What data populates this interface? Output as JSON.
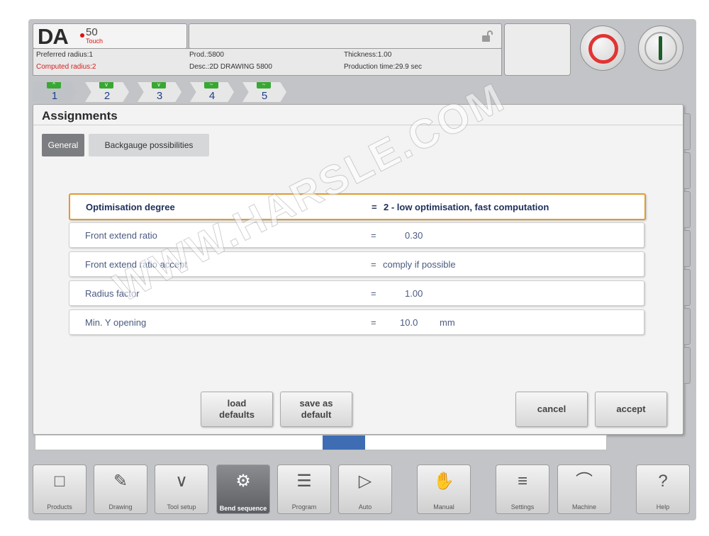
{
  "header": {
    "logo_brand": "DA",
    "logo_model": "50",
    "logo_sub": "Touch",
    "preferred_radius": "Preferred radius:1",
    "computed_radius": "Computed radius:2",
    "prod": "Prod.:5800",
    "desc": "Desc.:2D DRAWING 5800",
    "thickness": "Thickness:1.00",
    "production_time": "Production time:29.9 sec",
    "stop_color": "#e23434",
    "start_color": "#1c5d2a"
  },
  "bend_tabs": [
    {
      "num": "1",
      "badge": "^"
    },
    {
      "num": "2",
      "badge": "v"
    },
    {
      "num": "3",
      "badge": "v"
    },
    {
      "num": "4",
      "badge": "~"
    },
    {
      "num": "5",
      "badge": "~"
    }
  ],
  "dialog": {
    "title": "Assignments",
    "tabs": {
      "general": "General",
      "backgauge": "Backgauge possibilities"
    },
    "rows": [
      {
        "label": "Optimisation degree",
        "eq": "=",
        "value": "2 - low optimisation, fast computation",
        "unit": ""
      },
      {
        "label": "Front extend ratio",
        "eq": "=",
        "value": "0.30",
        "unit": ""
      },
      {
        "label": "Front extend ratio accept",
        "eq": "=",
        "value": "comply if possible",
        "unit": ""
      },
      {
        "label": "Radius factor",
        "eq": "=",
        "value": "1.00",
        "unit": ""
      },
      {
        "label": "Min. Y opening",
        "eq": "=",
        "value": "10.0",
        "unit": "mm"
      }
    ],
    "buttons": {
      "load_1": "load",
      "load_2": "defaults",
      "save_1": "save as",
      "save_2": "default",
      "cancel": "cancel",
      "accept": "accept"
    }
  },
  "nav": [
    {
      "label": "Products",
      "icon": "folder-icon"
    },
    {
      "label": "Drawing",
      "icon": "drawing-icon"
    },
    {
      "label": "Tool setup",
      "icon": "tool-icon"
    },
    {
      "label": "Bend sequence",
      "icon": "bend-sequence-icon"
    },
    {
      "label": "Program",
      "icon": "program-icon"
    },
    {
      "label": "Auto",
      "icon": "play-icon"
    },
    {
      "label": "Manual",
      "icon": "hand-icon"
    },
    {
      "label": "Settings",
      "icon": "settings-icon"
    },
    {
      "label": "Machine",
      "icon": "machine-icon"
    },
    {
      "label": "Help",
      "icon": "help-icon"
    }
  ],
  "watermark": "WWW.HARSLE.COM",
  "accent": "#e39a2e"
}
